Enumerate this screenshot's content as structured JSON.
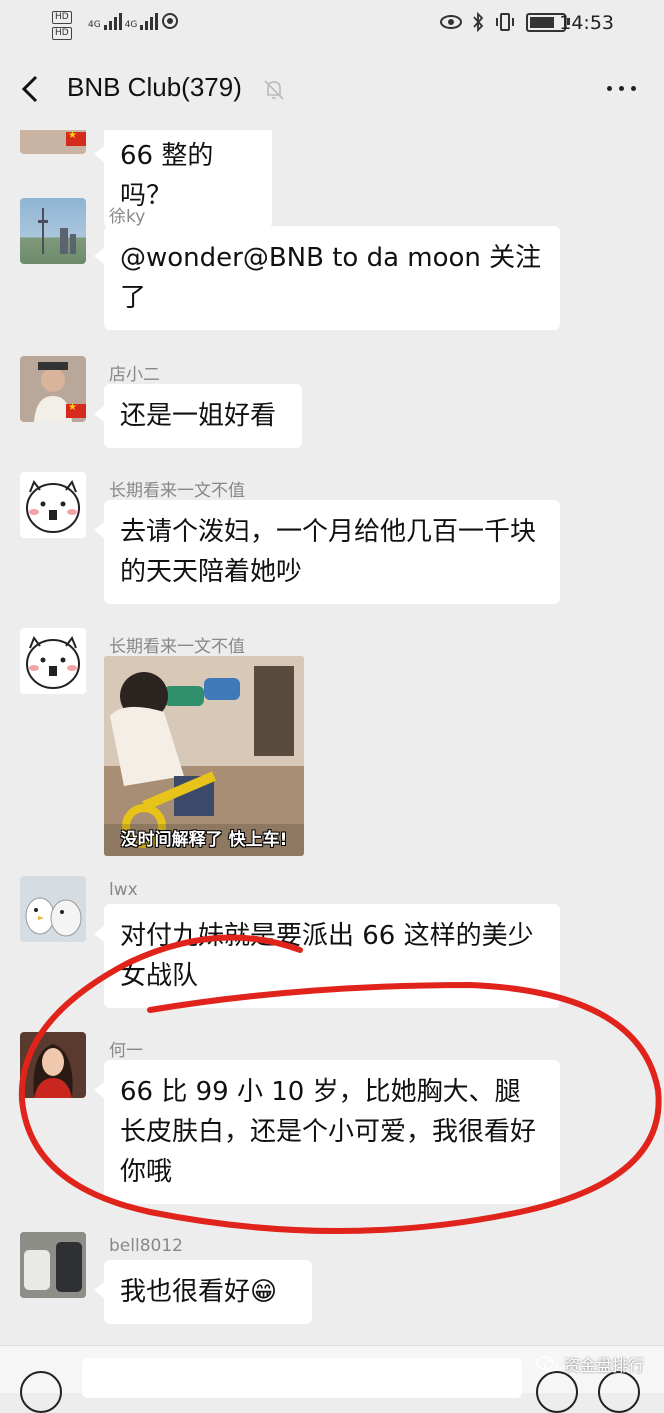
{
  "status_bar": {
    "net1": "HD",
    "net2": "HD",
    "net3": "4G",
    "net4": "4G",
    "time": "14:53",
    "battery_level": 0.85
  },
  "header": {
    "title": "BNB Club(379)"
  },
  "messages": [
    {
      "name": "",
      "text": "66 整的吗？"
    },
    {
      "name": "徐ky",
      "text": "@wonder@BNB to da moon 关注了"
    },
    {
      "name": "店小二",
      "text": "还是一姐好看"
    },
    {
      "name": "长期看来一文不值",
      "text": "去请个泼妇，一个月给他几百一千块的天天陪着她吵"
    },
    {
      "name": "长期看来一文不值",
      "image_caption": "没时间解释了 快上车!"
    },
    {
      "name": "lwx",
      "text": "对付九妹就是要派出 66 这样的美少女战队"
    },
    {
      "name": "何一",
      "text": "66 比 99 小 10 岁，比她胸大、腿长皮肤白，还是个小可爱，我很看好你哦"
    },
    {
      "name": "bell8012",
      "text": "我也很看好😁"
    }
  ],
  "watermark": {
    "text": "资金盘排行"
  },
  "colors": {
    "background": "#ededed",
    "bubble": "#ffffff",
    "annotation_loop": "#e0241b",
    "name_text": "#888888"
  },
  "icons": {
    "back": "chevron-left-icon",
    "mute": "bell-off-icon",
    "more": "more-dots-icon",
    "voice": "voice-icon",
    "emoji": "emoji-icon",
    "plus": "plus-icon"
  }
}
